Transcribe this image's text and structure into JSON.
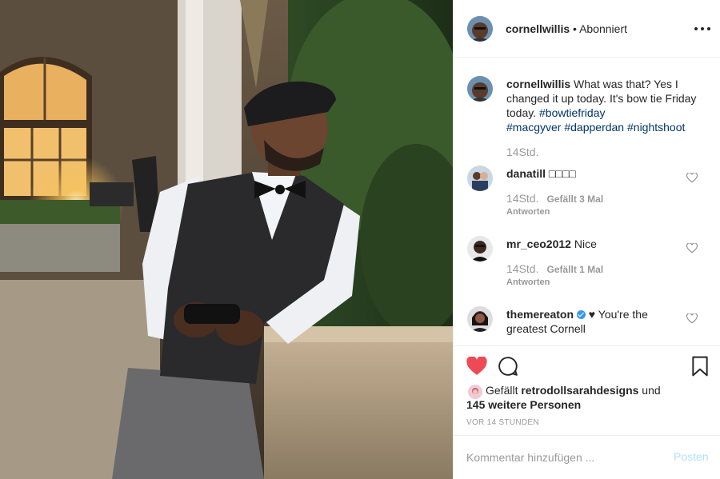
{
  "header": {
    "username": "cornellwillis",
    "separator": " • ",
    "follow_status": "Abonniert",
    "more_icon": "more-dots-icon"
  },
  "caption": {
    "username": "cornellwillis",
    "text": " What was that? Yes I changed it up today. It's bow tie Friday today. ",
    "hashtags": [
      "#bowtiefriday",
      "#macgyver",
      "#dapperdan",
      "#nightshoot"
    ],
    "time": "14Std."
  },
  "comments": [
    {
      "username": "danatill",
      "text": " □□□□",
      "time": "14Std.",
      "likes": "Gefällt 3 Mal",
      "reply": "Antworten"
    },
    {
      "username": "mr_ceo2012",
      "text": " Nice",
      "time": "14Std.",
      "likes": "Gefällt 1 Mal",
      "reply": "Antworten"
    },
    {
      "username": "themereaton",
      "verified": true,
      "text": " ♥ You're the greatest Cornell"
    }
  ],
  "likes": {
    "prefix": "Gefällt ",
    "user": "retrodollsarahdesigns",
    "middle": " und ",
    "others": "145 weitere Personen"
  },
  "timestamp": "VOR 14 STUNDEN",
  "comment_box": {
    "placeholder": "Kommentar hinzufügen ...",
    "post_label": "Posten"
  },
  "colors": {
    "like_red": "#ed4956",
    "hashtag": "#003569",
    "post_disabled": "#b2dffc",
    "muted": "#999999",
    "verified": "#3897f0"
  },
  "icons": [
    "heart-filled-icon",
    "comment-icon",
    "bookmark-icon",
    "heart-outline-icon",
    "more-dots-icon",
    "verified-icon"
  ]
}
